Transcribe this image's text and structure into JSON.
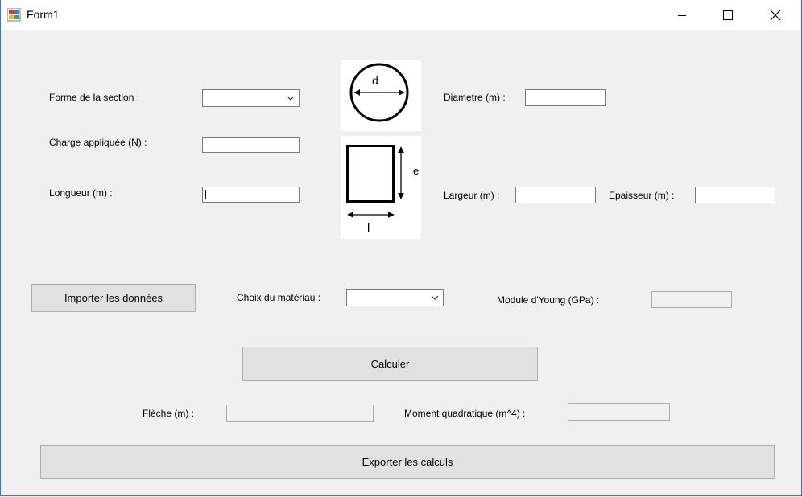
{
  "window": {
    "title": "Form1"
  },
  "icons": {
    "app": "form-app-icon",
    "minimize": "minimize-icon",
    "maximize": "maximize-icon",
    "close": "close-icon"
  },
  "labels": {
    "forme": "Forme de la section :",
    "charge": "Charge appliquée (N) :",
    "longueur": "Longueur (m) :",
    "diametre": "Diametre (m) :",
    "largeur": "Largeur (m) :",
    "epaisseur": "Epaisseur (m) :",
    "materiau": "Choix du matériau :",
    "young": "Module d'Young (GPa) :",
    "fleche": "Flèche (m) :",
    "moment": "Moment quadratique (m^4) :"
  },
  "fields": {
    "forme": "",
    "charge": "",
    "longueur": "",
    "diametre": "",
    "largeur": "",
    "epaisseur": "",
    "materiau": "",
    "young": "",
    "fleche": "",
    "moment": ""
  },
  "buttons": {
    "importer": "Importer les données",
    "calculer": "Calculer",
    "exporter": "Exporter les calculs"
  },
  "diagrams": {
    "circle_label": "d",
    "rect_height_label": "e",
    "rect_width_label": "l"
  }
}
